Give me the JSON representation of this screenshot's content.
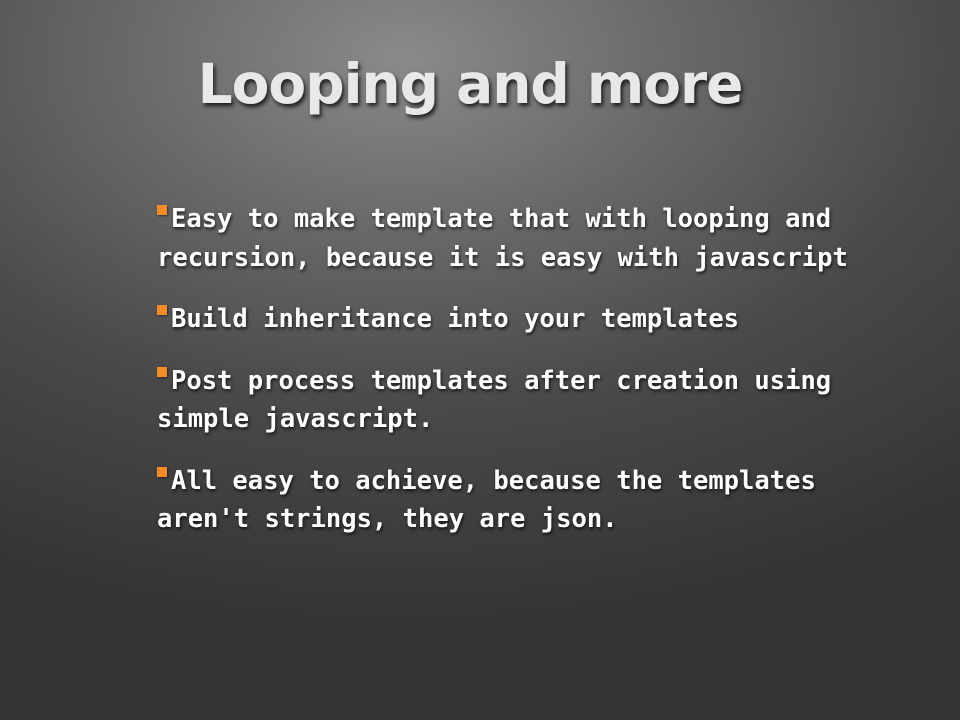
{
  "slide": {
    "title": "Looping and more",
    "marker_color": "#f28c28",
    "bullets": [
      "Easy to make template that with looping and recursion, because it is easy with javascript",
      "Build inheritance into your templates",
      "Post process templates after creation using simple javascript.",
      "All easy to achieve, because the templates aren't strings, they are json."
    ]
  }
}
